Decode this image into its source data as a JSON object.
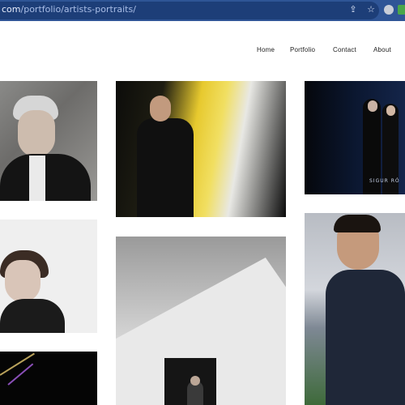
{
  "browser": {
    "url_prefix": "com",
    "url_path": "/portfolio/artists-portraits/",
    "icons": [
      "share-icon",
      "star-icon",
      "extension-icon",
      "extension-icon-green"
    ]
  },
  "nav": {
    "items": [
      "Home",
      "Portfolio",
      "Contact",
      "About"
    ]
  },
  "gallery": {
    "tiles": [
      {
        "subject": "portrait-man-grey-hair",
        "style": "color"
      },
      {
        "subject": "portrait-man-yellow-light",
        "style": "color"
      },
      {
        "subject": "band-portrait",
        "style": "color",
        "caption": "SIGUR RÓ"
      },
      {
        "subject": "portrait-woman",
        "style": "black-and-white"
      },
      {
        "subject": "circus-tent",
        "style": "black-and-white"
      },
      {
        "subject": "portrait-man-hoodie",
        "style": "color"
      },
      {
        "subject": "abstract-lines",
        "style": "color"
      }
    ]
  },
  "colors": {
    "chrome": "#2f5596",
    "page_background": "#ffffff",
    "nav_text": "#222222"
  }
}
